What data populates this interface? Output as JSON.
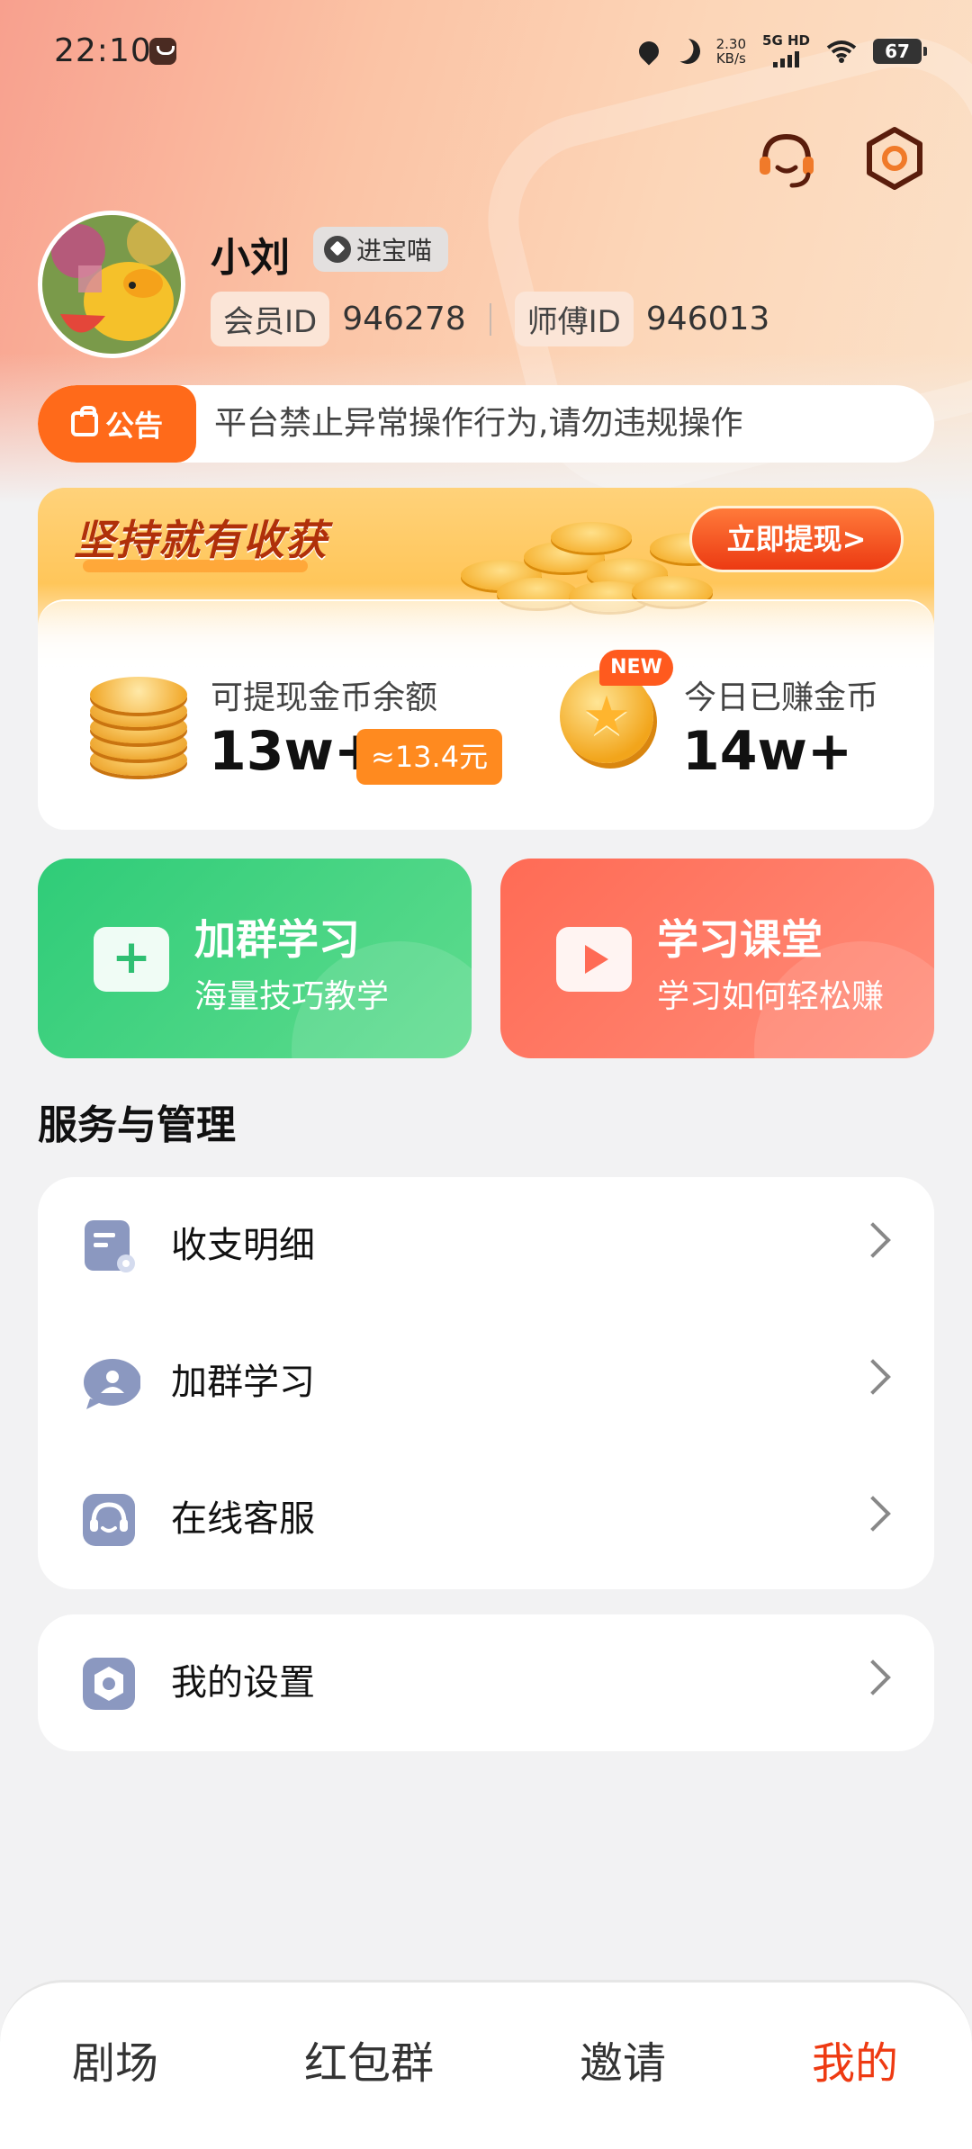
{
  "status_bar": {
    "time": "22:10",
    "net_speed_value": "2.30",
    "net_speed_unit": "KB/s",
    "network": "5G HD",
    "battery": "67"
  },
  "profile": {
    "name": "小刘",
    "badge": "进宝喵",
    "member_id_label": "会员ID",
    "member_id": "946278",
    "master_id_label": "师傅ID",
    "master_id": "946013"
  },
  "notice": {
    "tag": "公告",
    "text": "平台禁止异常操作行为,请勿违规操作"
  },
  "coins": {
    "slogan": "坚持就有收获",
    "withdraw_button": "立即提现>",
    "balance_label": "可提现金币余额",
    "balance_value": "13w+",
    "balance_approx": "≈13.4元",
    "new_badge": "NEW",
    "today_label": "今日已赚金币",
    "today_value": "14w+"
  },
  "actions": [
    {
      "title": "加群学习",
      "subtitle": "海量技巧教学",
      "color": "#2fcc78"
    },
    {
      "title": "学习课堂",
      "subtitle": "学习如何轻松赚",
      "color": "#ff6b55"
    }
  ],
  "services": {
    "title": "服务与管理",
    "items": [
      {
        "label": "收支明细",
        "icon": "ledger-icon"
      },
      {
        "label": "加群学习",
        "icon": "group-chat-icon"
      },
      {
        "label": "在线客服",
        "icon": "headset-icon"
      }
    ],
    "settings_item": {
      "label": "我的设置",
      "icon": "gear-icon"
    }
  },
  "tabs": [
    {
      "label": "剧场",
      "active": false
    },
    {
      "label": "红包群",
      "active": false
    },
    {
      "label": "邀请",
      "active": false
    },
    {
      "label": "我的",
      "active": true
    }
  ],
  "colors": {
    "accent": "#ff6a1a",
    "active_tab": "#ee3a12"
  }
}
